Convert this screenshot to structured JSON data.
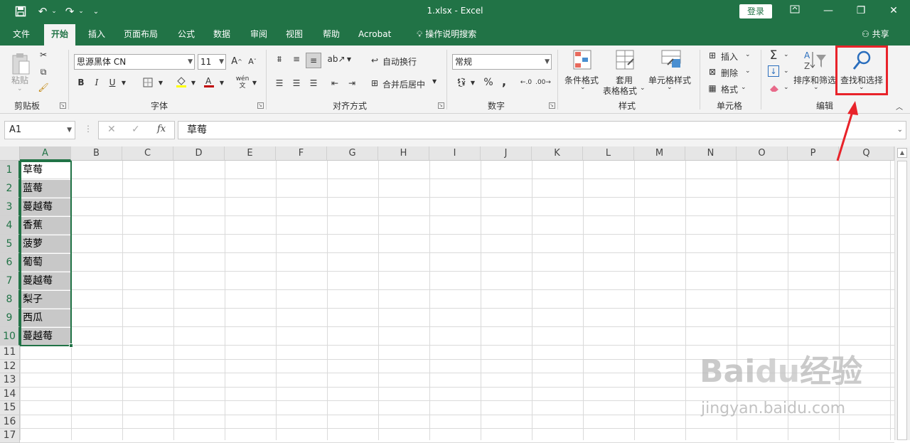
{
  "window": {
    "title": "1.xlsx  -  Excel",
    "login_label": "登录"
  },
  "quick_access": {
    "save_icon": "save-icon",
    "undo_icon": "undo-icon",
    "redo_icon": "redo-icon",
    "more": "⌄"
  },
  "menu": {
    "tabs": [
      "文件",
      "开始",
      "插入",
      "页面布局",
      "公式",
      "数据",
      "审阅",
      "视图",
      "帮助",
      "Acrobat"
    ],
    "active_tab": "开始",
    "search": "操作说明搜索",
    "share": "共享"
  },
  "ribbon": {
    "clipboard": {
      "label": "剪贴板",
      "paste": "粘贴"
    },
    "font": {
      "label": "字体",
      "font_name": "思源黑体 CN",
      "font_size": "11",
      "bold": "B",
      "italic": "I",
      "underline": "U",
      "phonetic": "wén"
    },
    "alignment": {
      "label": "对齐方式",
      "wrap_text": "自动换行",
      "merge_center": "合并后居中"
    },
    "number": {
      "label": "数字",
      "format": "常规",
      "percent": "%",
      "comma": ","
    },
    "styles": {
      "label": "样式",
      "conditional": "条件格式",
      "table_line1": "套用",
      "table_line2": "表格格式",
      "cell_styles": "单元格样式"
    },
    "cells": {
      "label": "单元格",
      "insert": "插入",
      "delete": "删除",
      "format": "格式"
    },
    "editing": {
      "label": "编辑",
      "sum": "Σ",
      "sort_filter": "排序和筛选",
      "find_select": "查找和选择"
    }
  },
  "formula_bar": {
    "name_box": "A1",
    "fx": "fx",
    "content": "草莓"
  },
  "columns": [
    "A",
    "B",
    "C",
    "D",
    "E",
    "F",
    "G",
    "H",
    "I",
    "J",
    "K",
    "L",
    "M",
    "N",
    "O",
    "P",
    "Q"
  ],
  "rows": [
    "1",
    "2",
    "3",
    "4",
    "5",
    "6",
    "7",
    "8",
    "9",
    "10",
    "11",
    "12",
    "13",
    "14",
    "15",
    "16",
    "17"
  ],
  "cells_a": [
    "草莓",
    "蓝莓",
    "蔓越莓",
    "香蕉",
    "菠萝",
    "葡萄",
    "蔓越莓",
    "梨子",
    "西瓜",
    "蔓越莓"
  ],
  "colors": {
    "excel_green": "#217346",
    "highlight_red": "#e8232a"
  }
}
